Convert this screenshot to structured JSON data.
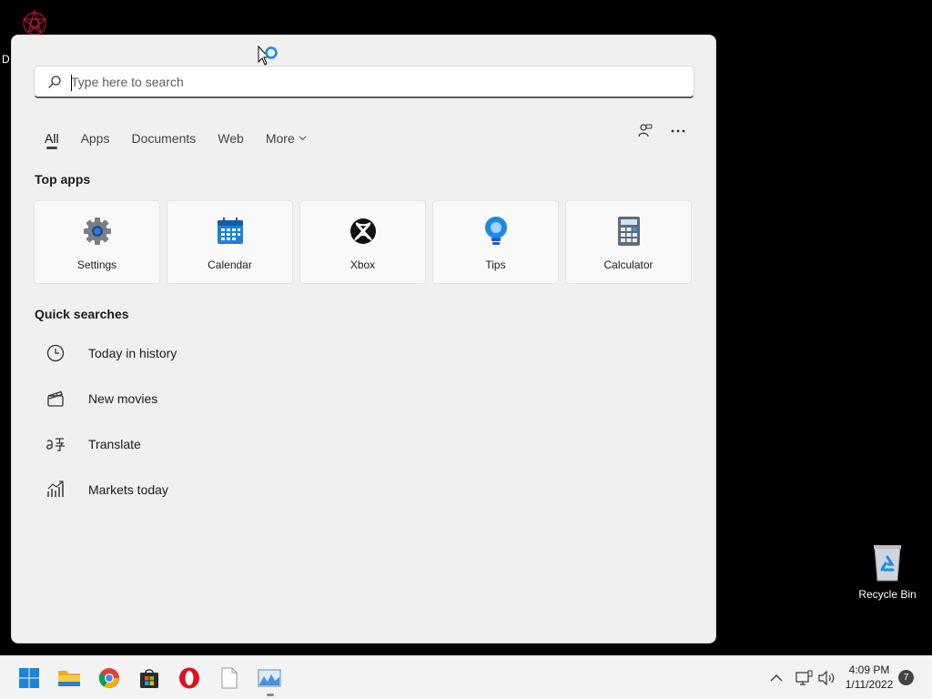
{
  "desktop": {
    "partial_label": "D",
    "recycle_bin_label": "Recycle Bin"
  },
  "search": {
    "placeholder": "Type here to search",
    "value": ""
  },
  "tabs": [
    {
      "label": "All",
      "active": true
    },
    {
      "label": "Apps"
    },
    {
      "label": "Documents"
    },
    {
      "label": "Web"
    },
    {
      "label": "More"
    }
  ],
  "top_apps": {
    "title": "Top apps",
    "items": [
      {
        "label": "Settings",
        "icon": "settings-icon"
      },
      {
        "label": "Calendar",
        "icon": "calendar-icon"
      },
      {
        "label": "Xbox",
        "icon": "xbox-icon"
      },
      {
        "label": "Tips",
        "icon": "tips-icon"
      },
      {
        "label": "Calculator",
        "icon": "calculator-icon"
      }
    ]
  },
  "quick_searches": {
    "title": "Quick searches",
    "items": [
      {
        "label": "Today in history",
        "icon": "clock-icon"
      },
      {
        "label": "New movies",
        "icon": "clapperboard-icon"
      },
      {
        "label": "Translate",
        "icon": "translate-icon"
      },
      {
        "label": "Markets today",
        "icon": "chart-icon"
      }
    ]
  },
  "taskbar": {
    "apps": [
      "start-icon",
      "file-explorer-icon",
      "chrome-icon",
      "store-icon",
      "opera-icon",
      "notepad-icon",
      "photo-app-icon"
    ],
    "time": "4:09 PM",
    "date": "1/11/2022",
    "notification_count": "7"
  },
  "colors": {
    "accent_blue": "#0078d4",
    "panel_bg": "#f0f0f0",
    "taskbar_bg": "#f3f3f3"
  }
}
